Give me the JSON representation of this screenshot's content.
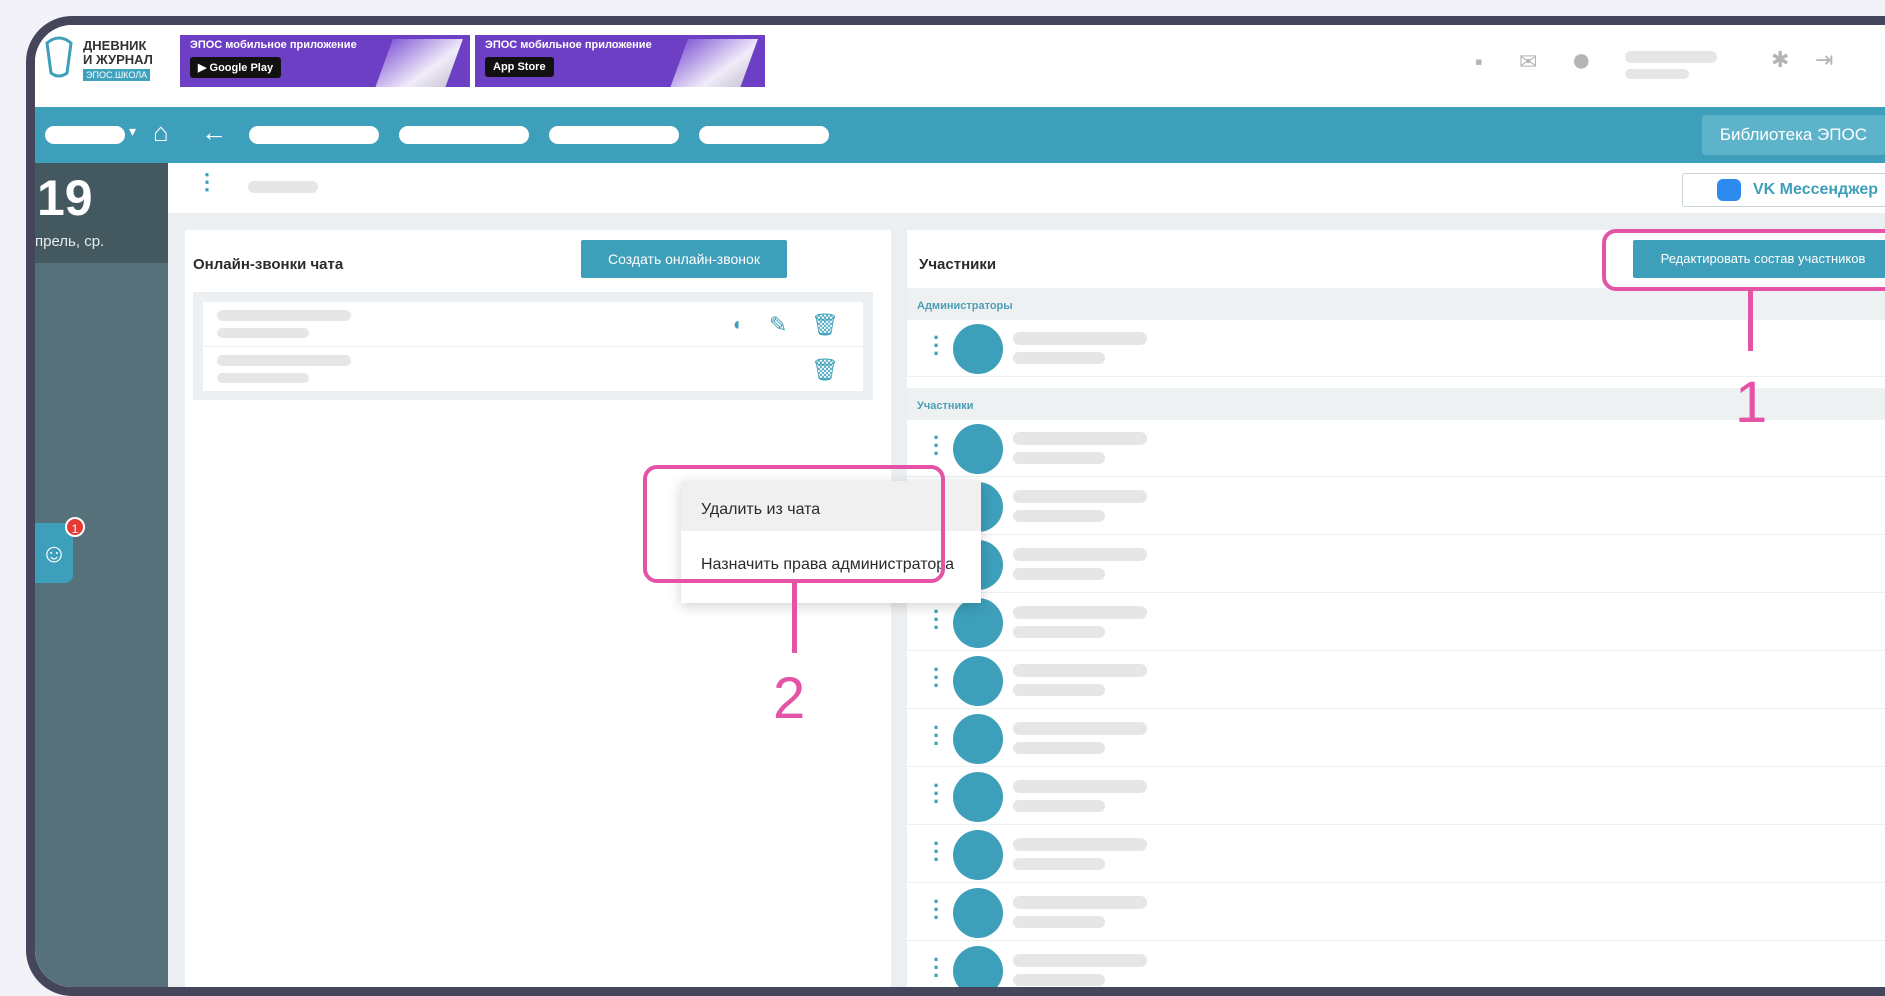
{
  "header": {
    "logo_line1": "ДНЕВНИК",
    "logo_line2": "И ЖУРНАЛ",
    "logo_sub": "ЭПОС.ШКОЛА",
    "promo_google": {
      "title": "ЭПОС мобильное приложение",
      "store": "Google Play"
    },
    "promo_apple": {
      "title": "ЭПОС мобильное приложение",
      "store": "App Store"
    }
  },
  "navbar": {
    "library_label": "Библиотека ЭПОС"
  },
  "sidebar": {
    "date_day": "19",
    "date_sub": "прель, ср.",
    "badge_count": "1"
  },
  "content_header": {
    "vk_label": "VK Мессенджер"
  },
  "calls_panel": {
    "title": "Онлайн-звонки чата",
    "create_button": "Создать онлайн-звонок"
  },
  "participants_panel": {
    "title": "Участники",
    "edit_button": "Редактировать состав участников",
    "admins_header": "Администраторы",
    "members_header": "Участники"
  },
  "context_menu": {
    "items": [
      "Удалить из чата",
      "Назначить права администратора"
    ]
  },
  "callouts": {
    "one": "1",
    "two": "2"
  },
  "colors": {
    "accent": "#3d9fba",
    "highlight": "#e553a6",
    "sidebar": "#57717a"
  }
}
